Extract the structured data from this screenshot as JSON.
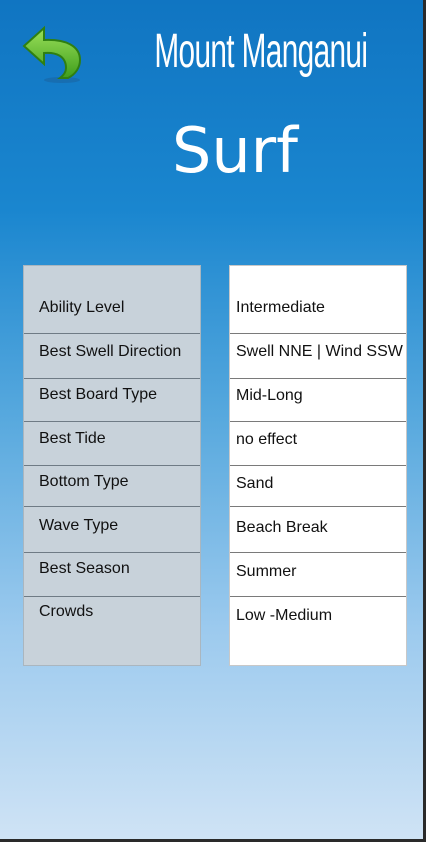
{
  "header": {
    "title_line1": "Mount Manganui",
    "title_line2": "Surf"
  },
  "icons": {
    "back": "back-arrow-icon"
  },
  "colors": {
    "back_arrow": "#5cbf2a",
    "label_panel": "#c8d2da",
    "value_panel": "#ffffff"
  },
  "details": [
    {
      "label": "Ability Level",
      "value": "Intermediate"
    },
    {
      "label": "Best Swell Direction",
      "value": "Swell NNE | Wind SSW"
    },
    {
      "label": "Best Board Type",
      "value": "Mid-Long"
    },
    {
      "label": "Best Tide",
      "value": "no effect"
    },
    {
      "label": "Bottom Type",
      "value": "Sand"
    },
    {
      "label": "Wave Type",
      "value": "Beach Break"
    },
    {
      "label": "Best Season",
      "value": "Summer"
    },
    {
      "label": "Crowds",
      "value": "Low -Medium"
    }
  ]
}
